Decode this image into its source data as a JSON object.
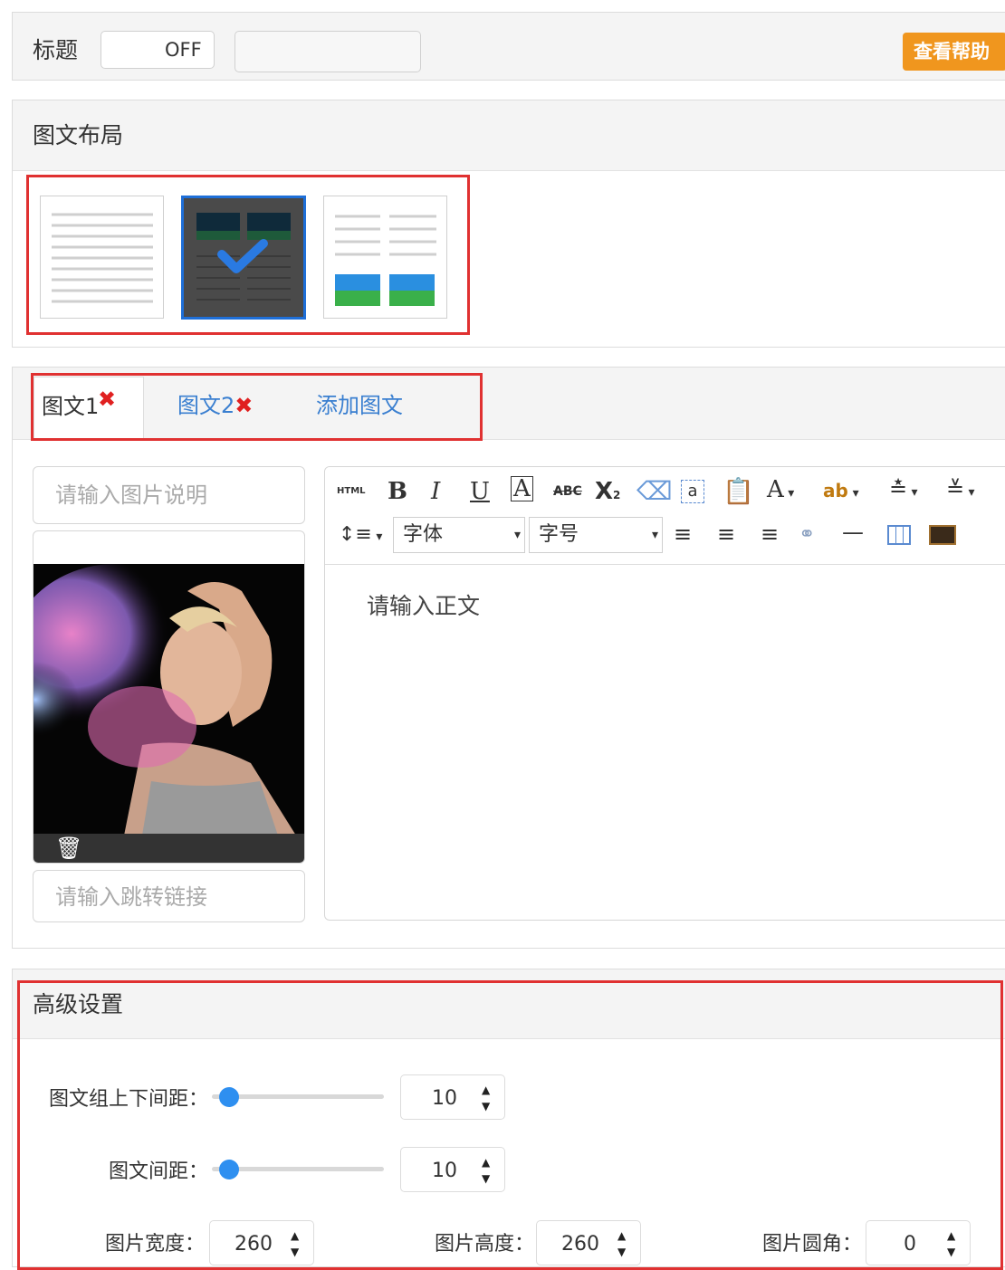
{
  "top": {
    "title_label": "标题",
    "toggle_state": "OFF",
    "title_value": "",
    "help_button": "查看帮助"
  },
  "layout_section": {
    "heading": "图文布局",
    "options": [
      {
        "name": "text-only",
        "selected": false
      },
      {
        "name": "image-top-two-col",
        "selected": true
      },
      {
        "name": "text-then-images",
        "selected": false
      }
    ]
  },
  "tabs": {
    "items": [
      {
        "label": "图文1",
        "active": true
      },
      {
        "label": "图文2",
        "active": false
      }
    ],
    "add_label": "添加图文"
  },
  "editor": {
    "image_caption_placeholder": "请输入图片说明",
    "link_placeholder": "请输入跳转链接",
    "body_placeholder": "请输入正文",
    "html_label": "HTML",
    "font_select": "字体",
    "size_select": "字号"
  },
  "advanced": {
    "heading": "高级设置",
    "group_spacing": {
      "label": "图文组上下间距：",
      "value": "10",
      "slider_fraction": 0.1
    },
    "item_spacing": {
      "label": "图文间距：",
      "value": "10",
      "slider_fraction": 0.1
    },
    "image_width": {
      "label": "图片宽度：",
      "value": "260"
    },
    "image_height": {
      "label": "图片高度：",
      "value": "260"
    },
    "image_radius": {
      "label": "图片圆角：",
      "value": "0"
    }
  },
  "colors": {
    "accent": "#f0961e",
    "selected_border": "#1e6fd8",
    "highlight": "#e03131",
    "link": "#3a7fd0",
    "slider": "#2e8ff0"
  }
}
